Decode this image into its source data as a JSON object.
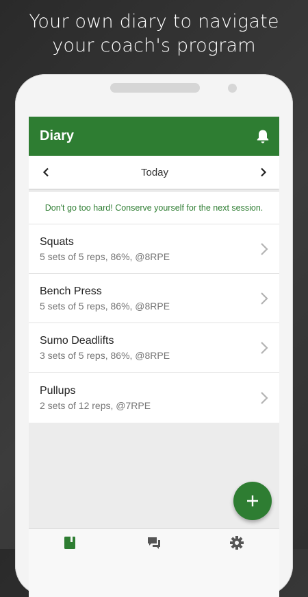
{
  "promo": {
    "line1": "Your own diary to navigate",
    "line2": "your coach's program"
  },
  "appbar": {
    "title": "Diary",
    "icon": "bell-icon"
  },
  "date_nav": {
    "label": "Today",
    "prev_icon": "chevron-left-icon",
    "next_icon": "chevron-right-icon"
  },
  "message": "Don't go too hard! Conserve yourself for the next session.",
  "exercises": [
    {
      "name": "Squats",
      "detail": "5 sets of 5 reps, 86%, @8RPE"
    },
    {
      "name": "Bench Press",
      "detail": "5 sets of 5 reps, 86%, @8RPE"
    },
    {
      "name": "Sumo Deadlifts",
      "detail": "3 sets of 5 reps, 86%, @8RPE"
    },
    {
      "name": "Pullups",
      "detail": "2 sets of 12 reps, @7RPE"
    }
  ],
  "fab": {
    "label": "+",
    "icon": "plus-icon"
  },
  "bottom_nav": [
    {
      "icon": "book-icon",
      "active": true
    },
    {
      "icon": "chat-icon",
      "active": false
    },
    {
      "icon": "gear-icon",
      "active": false
    }
  ],
  "colors": {
    "primary": "#2e7d32",
    "message_text": "#2e7d32",
    "secondary_text": "#757575"
  }
}
